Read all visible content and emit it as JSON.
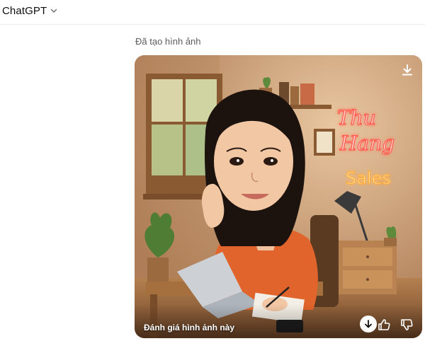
{
  "header": {
    "model_name": "ChatGPT",
    "chevron_icon": "chevron-down-icon"
  },
  "message": {
    "status_text": "Đã tạo hình ảnh"
  },
  "image": {
    "neon_line1": "Thu",
    "neon_line2": "Hang",
    "neon_line3": "Sales",
    "neon_color": "#ff6a5c",
    "neon_sales_color": "#ffb23f",
    "rating_prompt": "Đánh giá hình ảnh này",
    "download_icon": "download-icon",
    "thumbs_up_icon": "thumbs-up-icon",
    "thumbs_down_icon": "thumbs-down-icon"
  }
}
